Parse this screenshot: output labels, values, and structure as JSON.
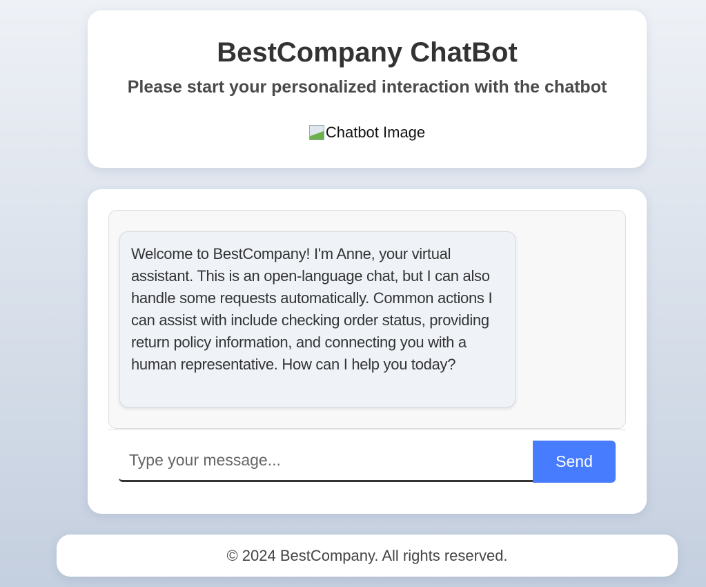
{
  "header": {
    "title": "BestCompany ChatBot",
    "subtitle": "Please start your personalized interaction with the chatbot",
    "image_alt": "Chatbot Image"
  },
  "chat": {
    "messages": [
      {
        "sender": "bot",
        "text": "Welcome to BestCompany! I'm Anne, your virtual assistant. This is an open-language chat, but I can also handle some requests automatically. Common actions I can assist with include checking order status, providing return policy information, and connecting you with a human representative. How can I help you today?"
      }
    ],
    "input_placeholder": "Type your message...",
    "input_value": "",
    "send_label": "Send"
  },
  "footer": {
    "text": "© 2024 BestCompany. All rights reserved."
  },
  "colors": {
    "accent": "#477cff",
    "bubble": "#eff3f8"
  }
}
